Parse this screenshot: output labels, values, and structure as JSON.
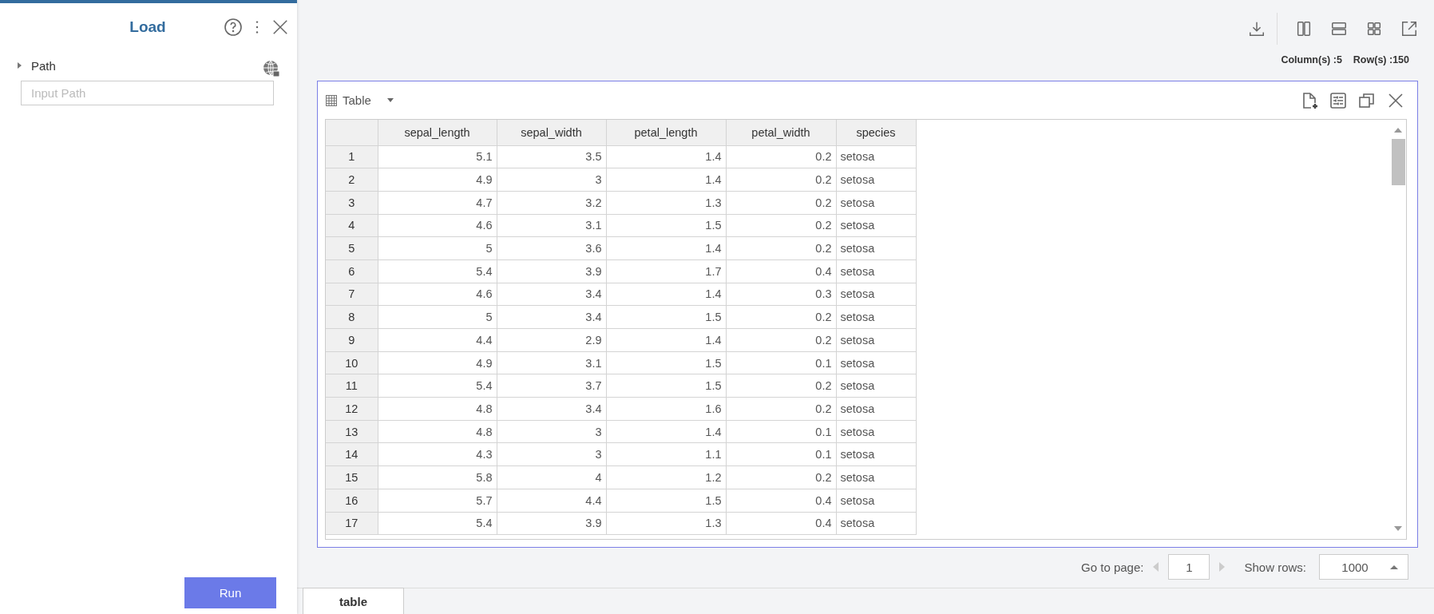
{
  "panel": {
    "title": "Load",
    "section": {
      "label": "Path",
      "expanded": false
    },
    "path_field": {
      "placeholder": "Input Path"
    },
    "run_button": "Run"
  },
  "summary": {
    "columns": "Column(s) :5",
    "rows": "Row(s) :150"
  },
  "view": {
    "title": "Table"
  },
  "table": {
    "columns": [
      "",
      "sepal_length",
      "sepal_width",
      "petal_length",
      "petal_width",
      "species"
    ],
    "rows": [
      [
        "1",
        "5.1",
        "3.5",
        "1.4",
        "0.2",
        "setosa"
      ],
      [
        "2",
        "4.9",
        "3",
        "1.4",
        "0.2",
        "setosa"
      ],
      [
        "3",
        "4.7",
        "3.2",
        "1.3",
        "0.2",
        "setosa"
      ],
      [
        "4",
        "4.6",
        "3.1",
        "1.5",
        "0.2",
        "setosa"
      ],
      [
        "5",
        "5",
        "3.6",
        "1.4",
        "0.2",
        "setosa"
      ],
      [
        "6",
        "5.4",
        "3.9",
        "1.7",
        "0.4",
        "setosa"
      ],
      [
        "7",
        "4.6",
        "3.4",
        "1.4",
        "0.3",
        "setosa"
      ],
      [
        "8",
        "5",
        "3.4",
        "1.5",
        "0.2",
        "setosa"
      ],
      [
        "9",
        "4.4",
        "2.9",
        "1.4",
        "0.2",
        "setosa"
      ],
      [
        "10",
        "4.9",
        "3.1",
        "1.5",
        "0.1",
        "setosa"
      ],
      [
        "11",
        "5.4",
        "3.7",
        "1.5",
        "0.2",
        "setosa"
      ],
      [
        "12",
        "4.8",
        "3.4",
        "1.6",
        "0.2",
        "setosa"
      ],
      [
        "13",
        "4.8",
        "3",
        "1.4",
        "0.1",
        "setosa"
      ],
      [
        "14",
        "4.3",
        "3",
        "1.1",
        "0.1",
        "setosa"
      ],
      [
        "15",
        "5.8",
        "4",
        "1.2",
        "0.2",
        "setosa"
      ],
      [
        "16",
        "5.7",
        "4.4",
        "1.5",
        "0.4",
        "setosa"
      ],
      [
        "17",
        "5.4",
        "3.9",
        "1.3",
        "0.4",
        "setosa"
      ]
    ]
  },
  "pager": {
    "page_label": "Go to page:",
    "page": "1",
    "rows_label": "Show rows:",
    "rows_value": "1000"
  },
  "tabs": [
    {
      "label": "table",
      "selected": true
    }
  ]
}
